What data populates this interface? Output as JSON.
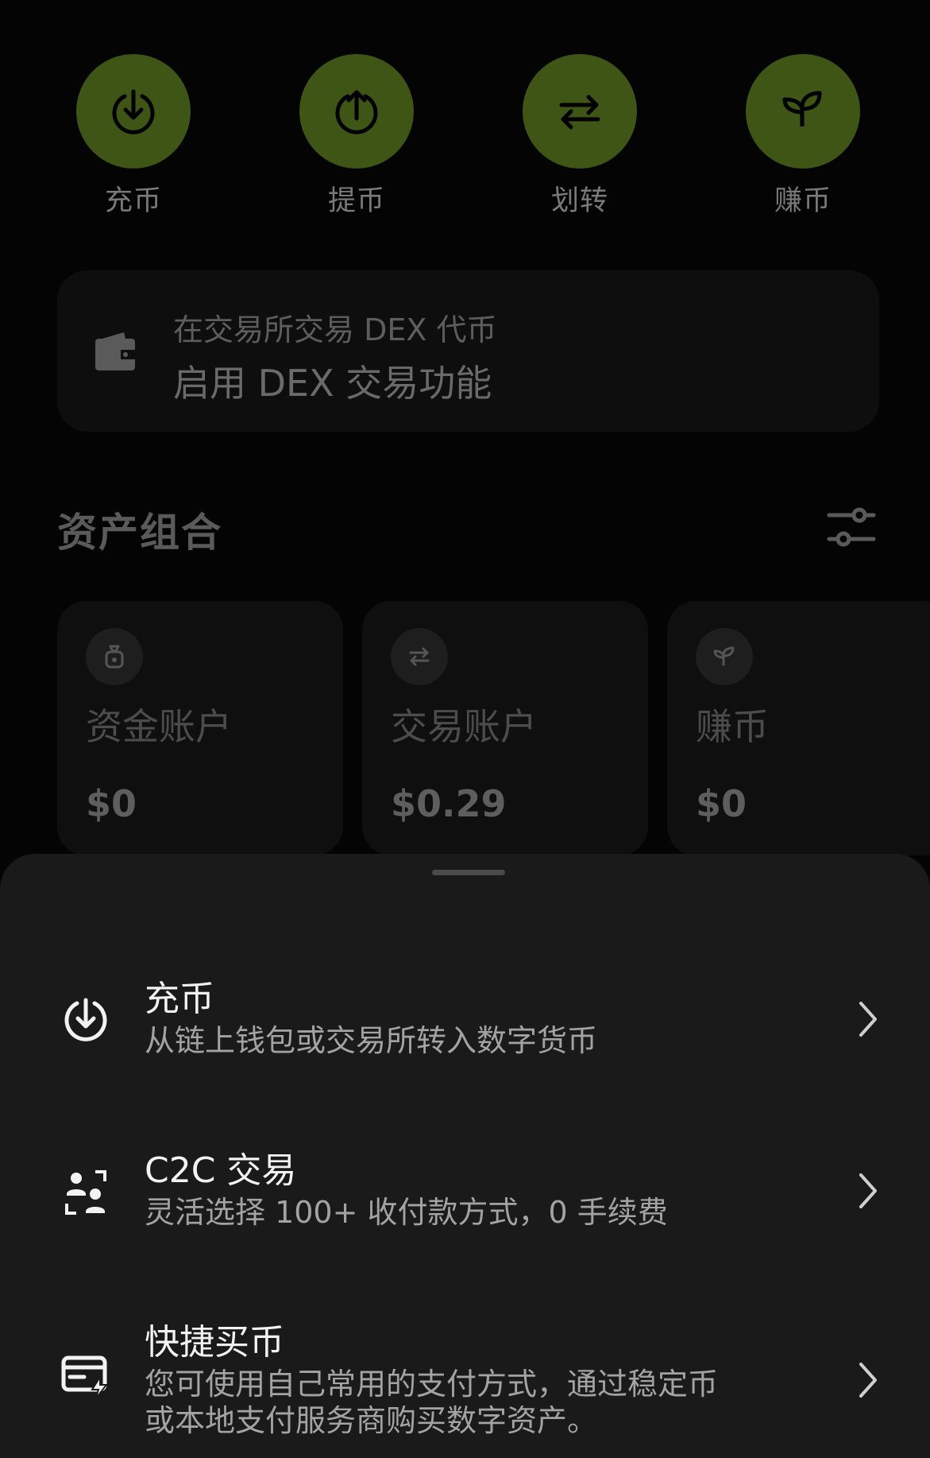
{
  "actions": [
    {
      "label": "充币",
      "icon": "download-circle-icon"
    },
    {
      "label": "提币",
      "icon": "upload-circle-icon"
    },
    {
      "label": "划转",
      "icon": "transfer-arrows-icon"
    },
    {
      "label": "赚币",
      "icon": "leaf-icon"
    }
  ],
  "dex_banner": {
    "line1": "在交易所交易 DEX 代币",
    "line2": "启用 DEX 交易功能",
    "icon": "wallet-icon"
  },
  "portfolio": {
    "title": "资产组合",
    "filter_icon": "sliders-icon",
    "accounts": [
      {
        "name": "资金账户",
        "value": "$0",
        "icon": "money-bag-icon"
      },
      {
        "name": "交易账户",
        "value": "$0.29",
        "icon": "transfer-arrows-icon"
      },
      {
        "name": "赚币",
        "value": "$0",
        "icon": "leaf-icon"
      }
    ]
  },
  "sheet": {
    "items": [
      {
        "title": "充币",
        "desc": "从链上钱包或交易所转入数字货币",
        "icon": "download-circle-icon"
      },
      {
        "title": "C2C 交易",
        "desc": "灵活选择 100+ 收付款方式，0 手续费",
        "icon": "c2c-users-icon"
      },
      {
        "title": "快捷买币",
        "desc": "您可使用自己常用的支付方式，通过稳定币\n或本地支付服务商购买数字资产。",
        "icon": "card-lightning-icon"
      }
    ]
  },
  "colors": {
    "accent_green": "#3f5516",
    "sheet_bg": "#1a1a1a"
  }
}
